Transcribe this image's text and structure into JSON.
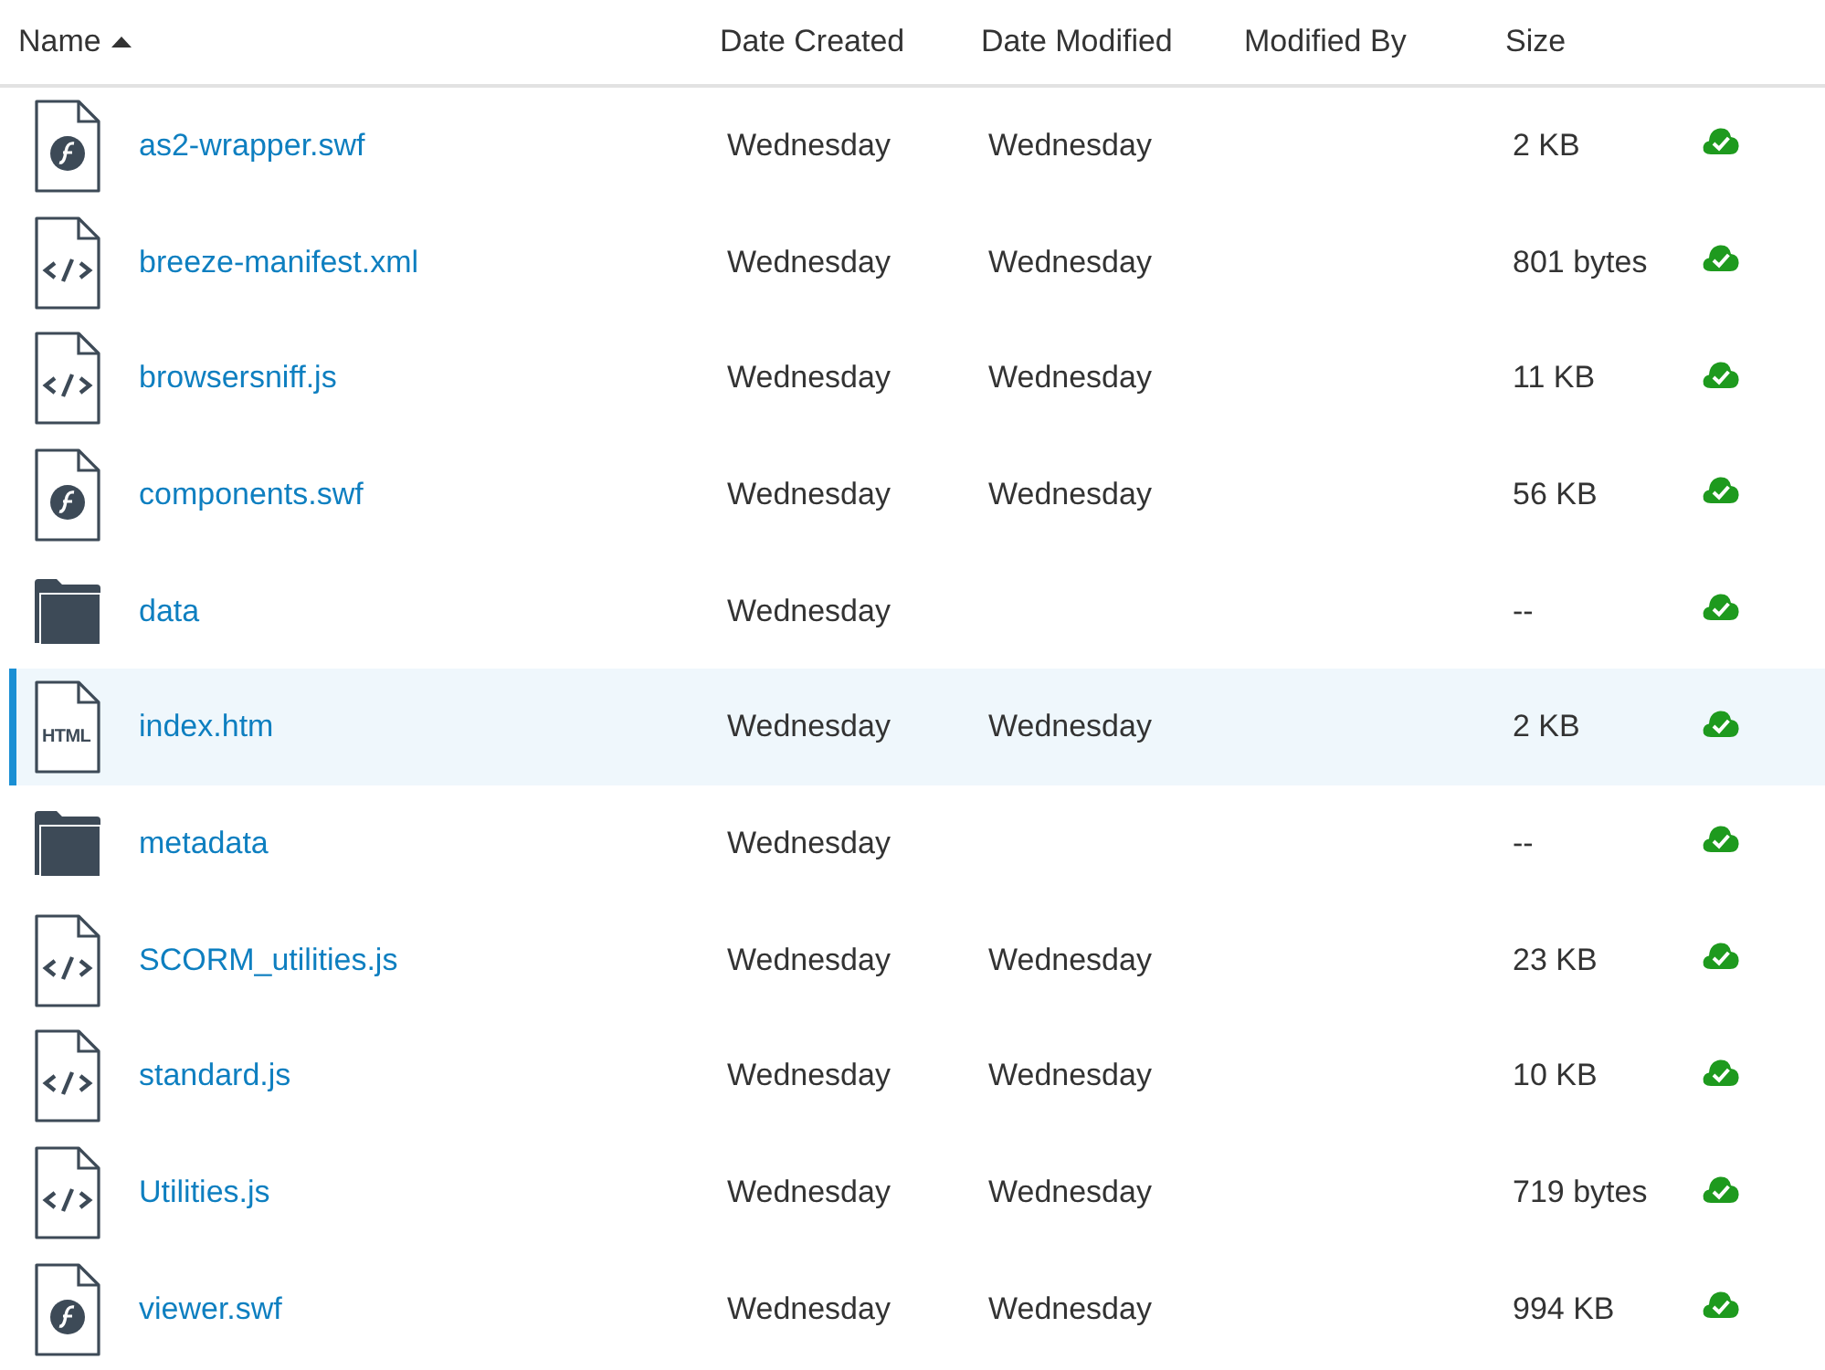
{
  "columns": [
    {
      "label": "Name",
      "sorted": true
    },
    {
      "label": "Date Created",
      "sorted": false
    },
    {
      "label": "Date Modified",
      "sorted": false
    },
    {
      "label": "Modified By",
      "sorted": false
    },
    {
      "label": "Size",
      "sorted": false
    }
  ],
  "rows": [
    {
      "kind": "flash",
      "name": "as2-wrapper.swf",
      "date_created": "Wednesday",
      "date_modified": "Wednesday",
      "size": "2 KB",
      "selected": false
    },
    {
      "kind": "code",
      "name": "breeze-manifest.xml",
      "date_created": "Wednesday",
      "date_modified": "Wednesday",
      "size": "801 bytes",
      "selected": false
    },
    {
      "kind": "code",
      "name": "browsersniff.js",
      "date_created": "Wednesday",
      "date_modified": "Wednesday",
      "size": "11 KB",
      "selected": false
    },
    {
      "kind": "flash",
      "name": "components.swf",
      "date_created": "Wednesday",
      "date_modified": "Wednesday",
      "size": "56 KB",
      "selected": false
    },
    {
      "kind": "folder",
      "name": "data",
      "date_created": "Wednesday",
      "size": "--",
      "selected": false
    },
    {
      "kind": "html",
      "icon_label": "HTML",
      "name": "index.htm",
      "date_created": "Wednesday",
      "date_modified": "Wednesday",
      "size": "2 KB",
      "selected": true
    },
    {
      "kind": "folder",
      "name": "metadata",
      "date_created": "Wednesday",
      "size": "--",
      "selected": false
    },
    {
      "kind": "code",
      "name": "SCORM_utilities.js",
      "date_created": "Wednesday",
      "date_modified": "Wednesday",
      "size": "23 KB",
      "selected": false
    },
    {
      "kind": "code",
      "name": "standard.js",
      "date_created": "Wednesday",
      "date_modified": "Wednesday",
      "size": "10 KB",
      "selected": false
    },
    {
      "kind": "code",
      "name": "Utilities.js",
      "date_created": "Wednesday",
      "date_modified": "Wednesday",
      "size": "719 bytes",
      "selected": false
    },
    {
      "kind": "flash",
      "name": "viewer.swf",
      "date_created": "Wednesday",
      "date_modified": "Wednesday",
      "size": "994 KB",
      "selected": false
    }
  ]
}
